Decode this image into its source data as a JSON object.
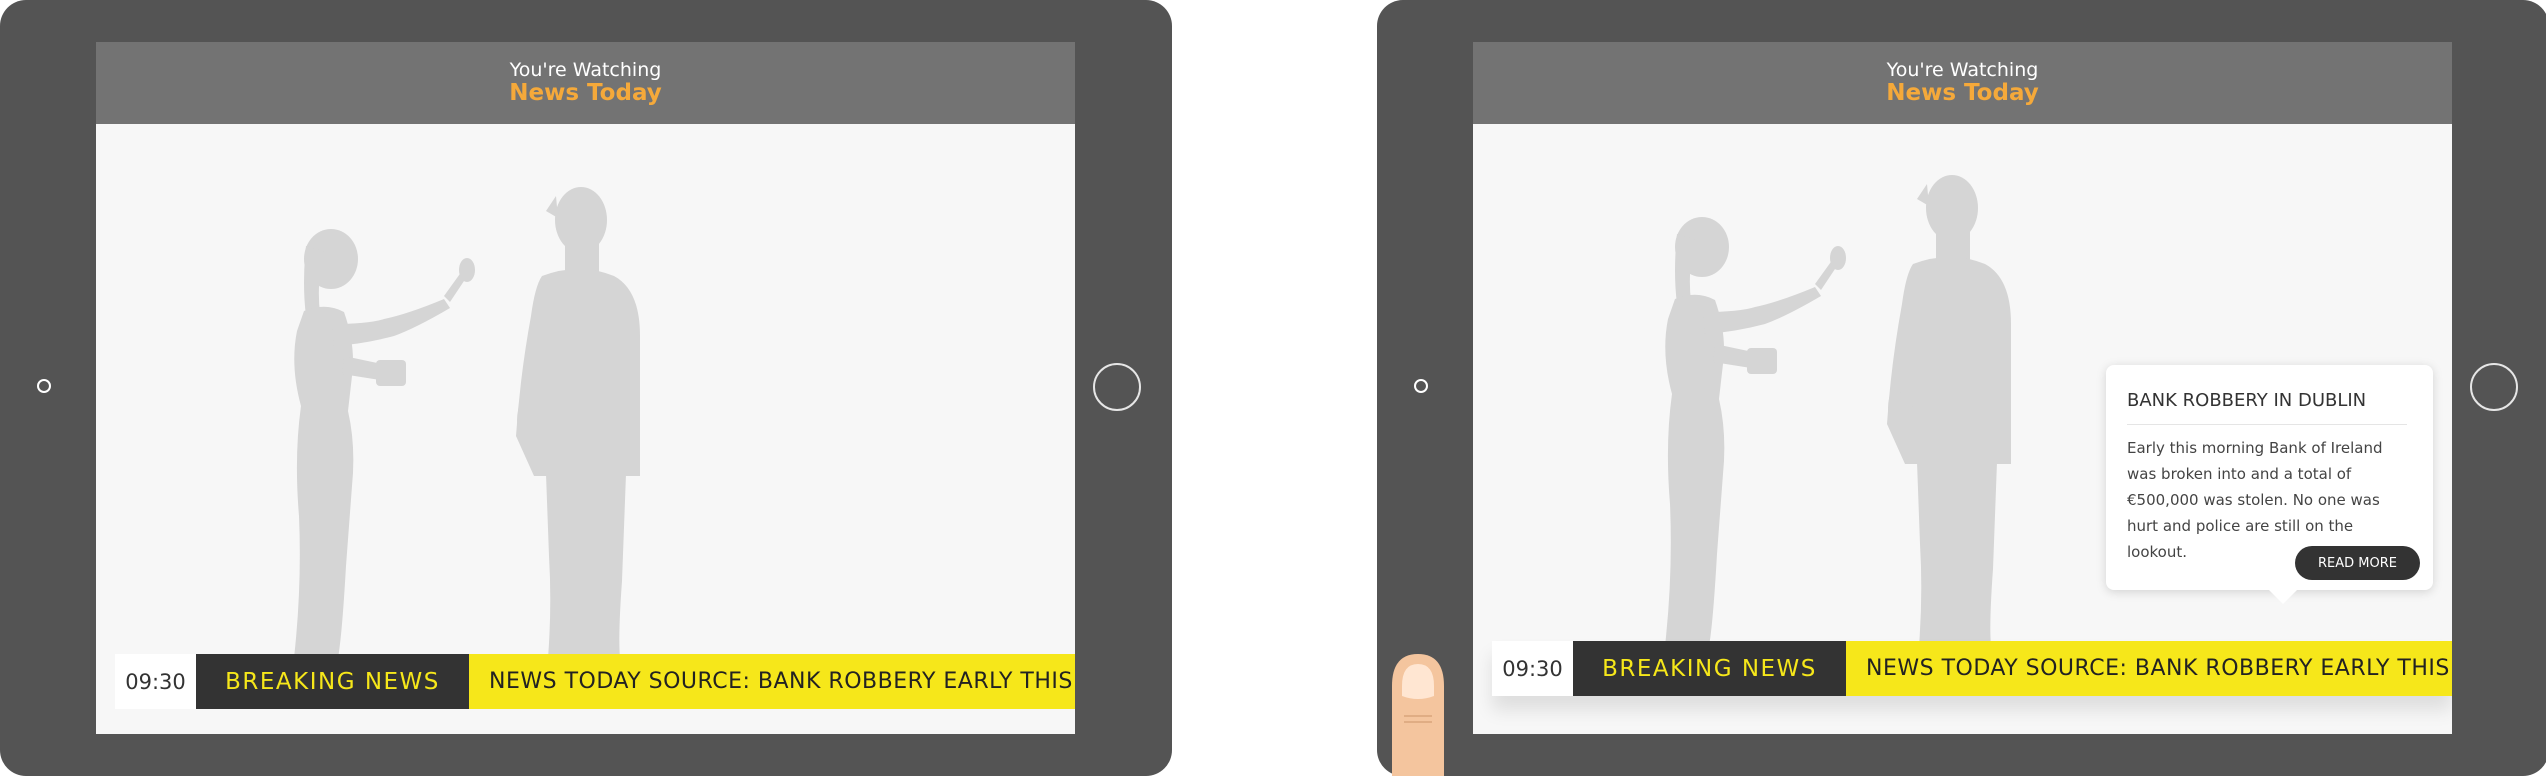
{
  "colors": {
    "bezel": "#545454",
    "header_bg": "#737373",
    "channel_accent": "#f5a93a",
    "ticker_yellow": "#f6e71a",
    "ticker_dark": "#333333"
  },
  "views": [
    {
      "header": {
        "subtitle": "You're Watching",
        "channel": "News Today"
      },
      "ticker": {
        "time": "09:30",
        "label": "BREAKING NEWS",
        "headline": "NEWS TODAY SOURCE: BANK ROBBERY EARLY THIS MORNING"
      }
    },
    {
      "header": {
        "subtitle": "You're Watching",
        "channel": "News Today"
      },
      "ticker": {
        "time": "09:30",
        "label": "BREAKING NEWS",
        "headline": "NEWS TODAY SOURCE: BANK ROBBERY EARLY THIS MORNING"
      },
      "popup": {
        "title": "BANK ROBBERY IN DUBLIN",
        "body": "Early this morning Bank of Ireland was broken into and a total of €500,000 was stolen. No one was hurt and police are still on the lookout.",
        "button": "READ MORE"
      }
    }
  ]
}
